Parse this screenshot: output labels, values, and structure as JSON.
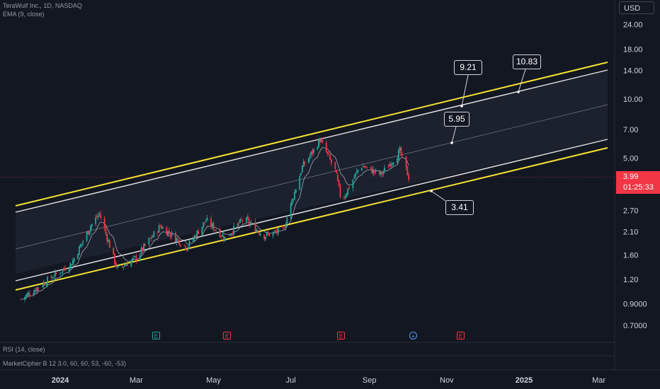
{
  "header": {
    "title": "TeraWulf Inc., 1D, NASDAQ",
    "indicator": "EMA (9, close)"
  },
  "currency": "USD",
  "last_price": {
    "value": "3.99",
    "countdown": "01:25:33"
  },
  "annotations": [
    {
      "id": "a921",
      "label": "9.21"
    },
    {
      "id": "a1083",
      "label": "10.83"
    },
    {
      "id": "a595",
      "label": "5.95"
    },
    {
      "id": "a341",
      "label": "3.41"
    }
  ],
  "events": [
    {
      "id": "e1",
      "letter": "E",
      "color": "#26a69a"
    },
    {
      "id": "e2",
      "letter": "E",
      "color": "#f23645"
    },
    {
      "id": "e3",
      "letter": "E",
      "color": "#f23645"
    },
    {
      "id": "e4",
      "letter": "+",
      "color": "#5b9cf6"
    },
    {
      "id": "e5",
      "letter": "E",
      "color": "#f23645"
    }
  ],
  "panes": {
    "rsi": "RSI (14, close)",
    "cipher": "MarketCipher B 12 3.0, 60, 60, 53, -60, -53)"
  },
  "colors": {
    "up": "#26a69a",
    "down": "#f23645",
    "channel_outer": "#f5e232",
    "channel_inner": "#e8e8e8",
    "ema": "#b2b5be"
  },
  "chart_data": {
    "type": "candlestick",
    "scale": "log",
    "y_ticks": [
      "24.00",
      "18.00",
      "14.00",
      "10.00",
      "7.00",
      "5.00",
      "3.99",
      "2.70",
      "2.10",
      "1.60",
      "1.20",
      "0.9000",
      "0.7000"
    ],
    "x_ticks": [
      "2024",
      "Mar",
      "May",
      "Jul",
      "Sep",
      "Nov",
      "2025",
      "Mar"
    ],
    "ylim": [
      0.6,
      28
    ],
    "approx_close_path": [
      {
        "date": "2023-12",
        "close": 0.95
      },
      {
        "date": "2024-01-10",
        "close": 1.45
      },
      {
        "date": "2024-01-25",
        "close": 2.25
      },
      {
        "date": "2024-02-01",
        "close": 2.6
      },
      {
        "date": "2024-02-15",
        "close": 1.35
      },
      {
        "date": "2024-03-01",
        "close": 1.55
      },
      {
        "date": "2024-03-20",
        "close": 2.25
      },
      {
        "date": "2024-04-10",
        "close": 1.75
      },
      {
        "date": "2024-04-25",
        "close": 2.4
      },
      {
        "date": "2024-05-10",
        "close": 1.95
      },
      {
        "date": "2024-05-25",
        "close": 2.45
      },
      {
        "date": "2024-06-10",
        "close": 2.0
      },
      {
        "date": "2024-06-25",
        "close": 2.15
      },
      {
        "date": "2024-07-10",
        "close": 4.5
      },
      {
        "date": "2024-07-20",
        "close": 5.6
      },
      {
        "date": "2024-07-24",
        "close": 6.2
      },
      {
        "date": "2024-08-05",
        "close": 4.3
      },
      {
        "date": "2024-08-10",
        "close": 3.0
      },
      {
        "date": "2024-08-25",
        "close": 4.6
      },
      {
        "date": "2024-09-10",
        "close": 4.1
      },
      {
        "date": "2024-09-25",
        "close": 5.4
      },
      {
        "date": "2024-10-02",
        "close": 3.99
      }
    ]
  }
}
